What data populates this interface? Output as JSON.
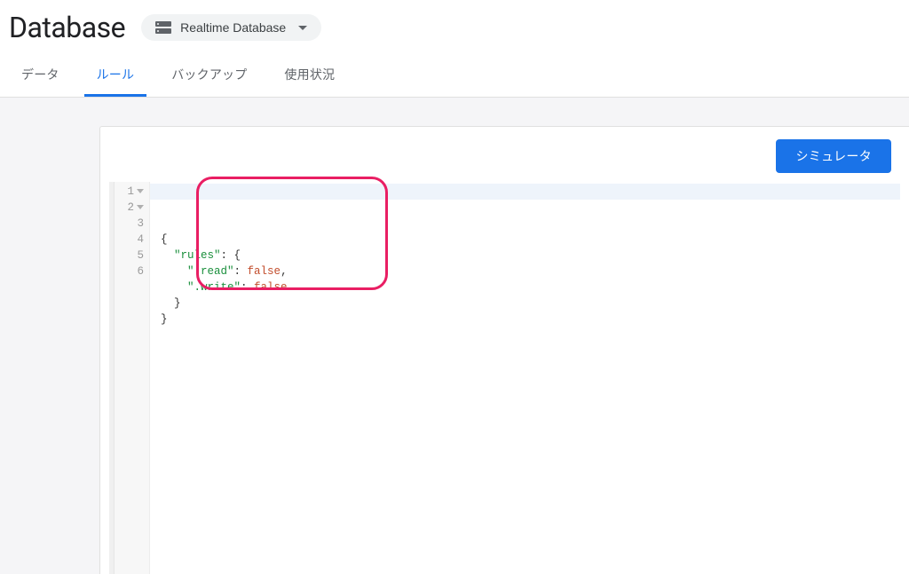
{
  "header": {
    "title": "Database",
    "selector_label": "Realtime Database"
  },
  "tabs": {
    "items": [
      {
        "label": "データ",
        "active": false
      },
      {
        "label": "ルール",
        "active": true
      },
      {
        "label": "バックアップ",
        "active": false
      },
      {
        "label": "使用状況",
        "active": false
      }
    ]
  },
  "toolbar": {
    "simulator_label": "シミュレータ"
  },
  "editor": {
    "line_numbers": [
      "1",
      "2",
      "3",
      "4",
      "5",
      "6"
    ],
    "fold_lines": [
      1,
      2
    ],
    "code": {
      "l1": "{",
      "l2_key": "\"rules\"",
      "l2_rest": ": {",
      "l3_key": "\".read\"",
      "l3_colon": ": ",
      "l3_val": "false",
      "l3_comma": ",",
      "l4_key": "\".write\"",
      "l4_colon": ": ",
      "l4_val": "false",
      "l5": "  }",
      "l6": "}"
    }
  }
}
